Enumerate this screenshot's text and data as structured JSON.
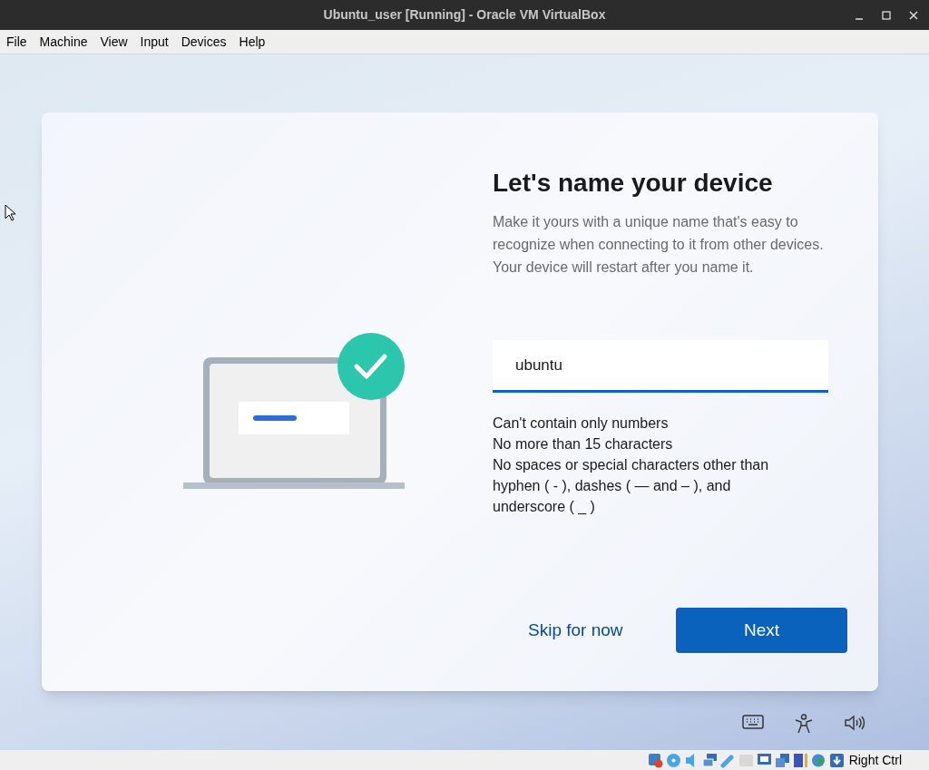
{
  "window": {
    "title": "Ubuntu_user [Running] - Oracle VM VirtualBox"
  },
  "menu": [
    "File",
    "Machine",
    "View",
    "Input",
    "Devices",
    "Help"
  ],
  "setup": {
    "title": "Let's name your device",
    "description": "Make it yours with a unique name that's easy to recognize when connecting to it from other devices. Your device will restart after you name it.",
    "name_field": {
      "value": "ubuntu"
    },
    "rules": [
      "Can't contain only numbers",
      "No more than 15 characters",
      "No spaces or special characters other than hyphen ( - ), dashes ( — and – ), and underscore ( _ )"
    ],
    "skip_link": "Skip for now",
    "next_button": "Next"
  },
  "status_bar": {
    "host_key": "Right Ctrl"
  }
}
